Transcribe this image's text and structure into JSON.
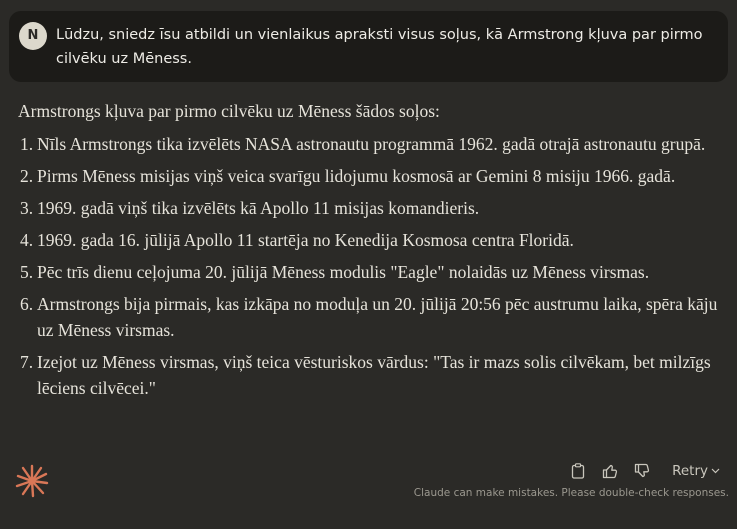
{
  "user_message": {
    "avatar_initial": "N",
    "text": "Lūdzu, sniedz īsu atbildi un vienlaikus apraksti visus soļus, kā Armstrong kļuva par pirmo cilvēku uz Mēness."
  },
  "assistant_reply": {
    "intro": "Armstrongs kļuva par pirmo cilvēku uz Mēness šādos soļos:",
    "steps": [
      {
        "num": "1.",
        "text": "Nīls Armstrongs tika izvēlēts NASA astronautu programmā 1962. gadā otrajā astronautu grupā."
      },
      {
        "num": "2.",
        "text": "Pirms Mēness misijas viņš veica svarīgu lidojumu kosmosā ar Gemini 8 misiju 1966. gadā."
      },
      {
        "num": "3.",
        "text": "1969. gadā viņš tika izvēlēts kā Apollo 11 misijas komandieris."
      },
      {
        "num": "4.",
        "text": "1969. gada 16. jūlijā Apollo 11 startēja no Kenedija Kosmosa centra Floridā."
      },
      {
        "num": "5.",
        "text": "Pēc trīs dienu ceļojuma 20. jūlijā Mēness modulis \"Eagle\" nolaidās uz Mēness virsmas."
      },
      {
        "num": "6.",
        "text": "Armstrongs bija pirmais, kas izkāpa no moduļa un 20. jūlijā 20:56 pēc austrumu laika, spēra kāju uz Mēness virsmas."
      },
      {
        "num": "7.",
        "text": "Izejot uz Mēness virsmas, viņš teica vēsturiskos vārdus: \"Tas ir mazs solis cilvēkam, bet milzīgs lēciens cilvēcei.\""
      }
    ]
  },
  "actions": {
    "copy_icon": "clipboard-icon",
    "like_icon": "thumbs-up-icon",
    "dislike_icon": "thumbs-down-icon",
    "retry_label": "Retry"
  },
  "disclaimer": "Claude can make mistakes. Please double-check responses.",
  "colors": {
    "background": "#2b2a27",
    "user_bubble": "#1c1b18",
    "accent_logo": "#d97757"
  }
}
